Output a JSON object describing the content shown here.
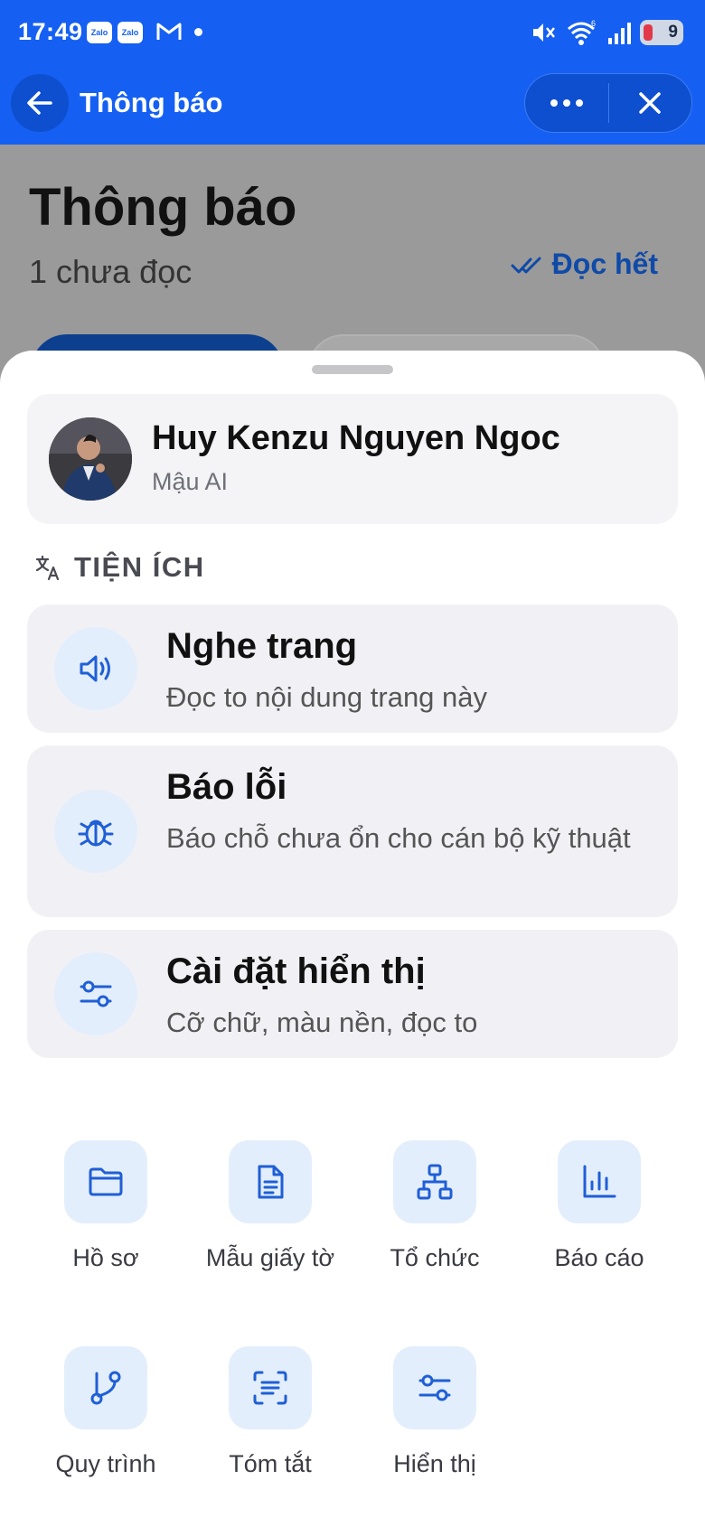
{
  "status_bar": {
    "time": "17:49",
    "apps": [
      "Zalo",
      "Zalo"
    ],
    "battery": "9"
  },
  "app_bar": {
    "title": "Thông báo"
  },
  "page": {
    "title": "Thông báo",
    "unread": "1 chưa đọc",
    "read_all": "Đọc hết"
  },
  "sheet": {
    "user": {
      "name": "Huy Kenzu Nguyen Ngoc",
      "org": "Mậu AI"
    },
    "section_label": "TIỆN ÍCH",
    "cards": [
      {
        "title": "Nghe trang",
        "subtitle": "Đọc to nội dung trang này",
        "icon": "speaker-icon"
      },
      {
        "title": "Báo lỗi",
        "subtitle": "Báo chỗ chưa ổn cho cán bộ kỹ thuật",
        "icon": "bug-icon"
      },
      {
        "title": "Cài đặt hiển thị",
        "subtitle": "Cỡ chữ, màu nền, đọc to",
        "icon": "sliders-icon"
      }
    ],
    "grid": [
      {
        "label": "Hồ sơ",
        "icon": "folder-icon"
      },
      {
        "label": "Mẫu giấy tờ",
        "icon": "document-icon"
      },
      {
        "label": "Tổ chức",
        "icon": "org-chart-icon"
      },
      {
        "label": "Báo cáo",
        "icon": "bar-chart-icon"
      },
      {
        "label": "Quy trình",
        "icon": "workflow-icon"
      },
      {
        "label": "Tóm tắt",
        "icon": "scan-text-icon"
      },
      {
        "label": "Hiển thị",
        "icon": "sliders-icon"
      }
    ]
  },
  "colors": {
    "primary": "#1560f2",
    "icon_accent": "#1f5fd6",
    "icon_bg": "#e3eefc",
    "card_bg": "#f1f1f5"
  }
}
